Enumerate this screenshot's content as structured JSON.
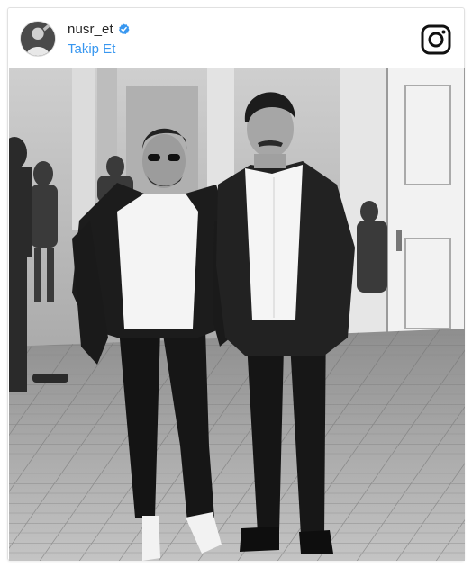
{
  "post": {
    "username": "nusr_et",
    "follow_label": "Takip Et",
    "verified": true
  },
  "icons": {
    "verified": "verified-badge-icon",
    "brand": "instagram-icon"
  },
  "colors": {
    "follow_link": "#3897f0",
    "verified_badge": "#3897f0",
    "username": "#262626"
  }
}
